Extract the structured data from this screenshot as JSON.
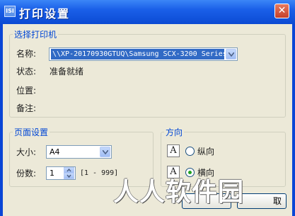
{
  "window": {
    "title": "打印设置",
    "app_icon_text": "ISI",
    "close_label": "✕"
  },
  "printer_group": {
    "legend": "选择打印机",
    "name_label": "名称:",
    "name_value": "\\\\XP-20170930GTUQ\\Samsung SCX-3200 Series",
    "status_label": "状态:",
    "status_value": "准备就绪",
    "location_label": "位置:",
    "comment_label": "备注:"
  },
  "page_group": {
    "legend": "页面设置",
    "size_label": "大小:",
    "size_value": "A4",
    "copies_label": "份数:",
    "copies_value": "1",
    "copies_range": "[1 - 999]"
  },
  "orientation_group": {
    "legend": "方向",
    "portrait_glyph": "A",
    "portrait_label": "纵向",
    "landscape_glyph": "A",
    "landscape_label": "横向",
    "selected": "landscape"
  },
  "footer": {
    "cancel_partial": "取",
    "watermark": "人人软件园"
  },
  "colors": {
    "titlebar": "#0b4ad3",
    "client": "#ece9d8",
    "legend_text": "#0046d5",
    "selection": "#316ac5",
    "radio_selected": "#21a121"
  }
}
